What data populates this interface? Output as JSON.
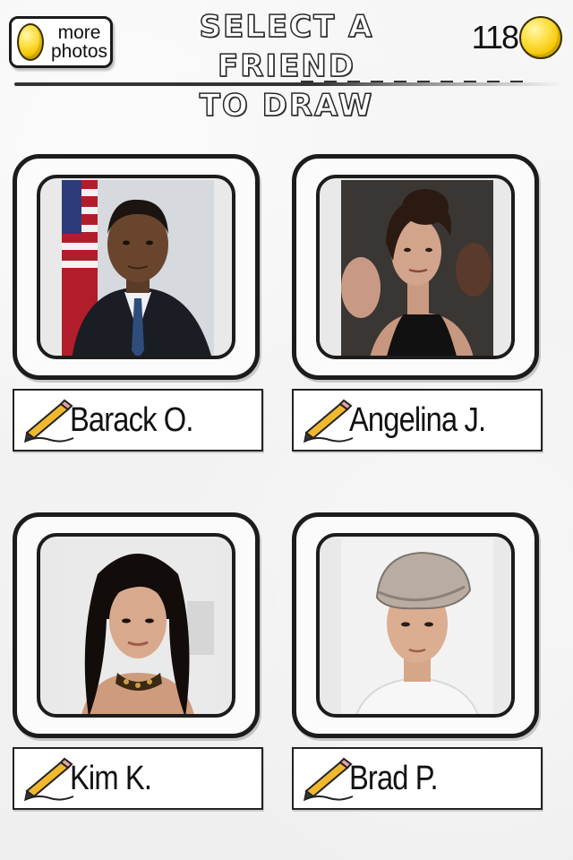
{
  "header": {
    "more_photos_line1": "more",
    "more_photos_line2": "photos",
    "title_line1": "SELECT A FRIEND",
    "title_line2": "TO DRAW",
    "coins": "118"
  },
  "friends": [
    {
      "name": "Barack O."
    },
    {
      "name": "Angelina J."
    },
    {
      "name": "Kim K."
    },
    {
      "name": "Brad P."
    }
  ],
  "colors": {
    "coin": "#f3c500",
    "ink": "#1c1c1c",
    "background": "#f3f3f3"
  }
}
